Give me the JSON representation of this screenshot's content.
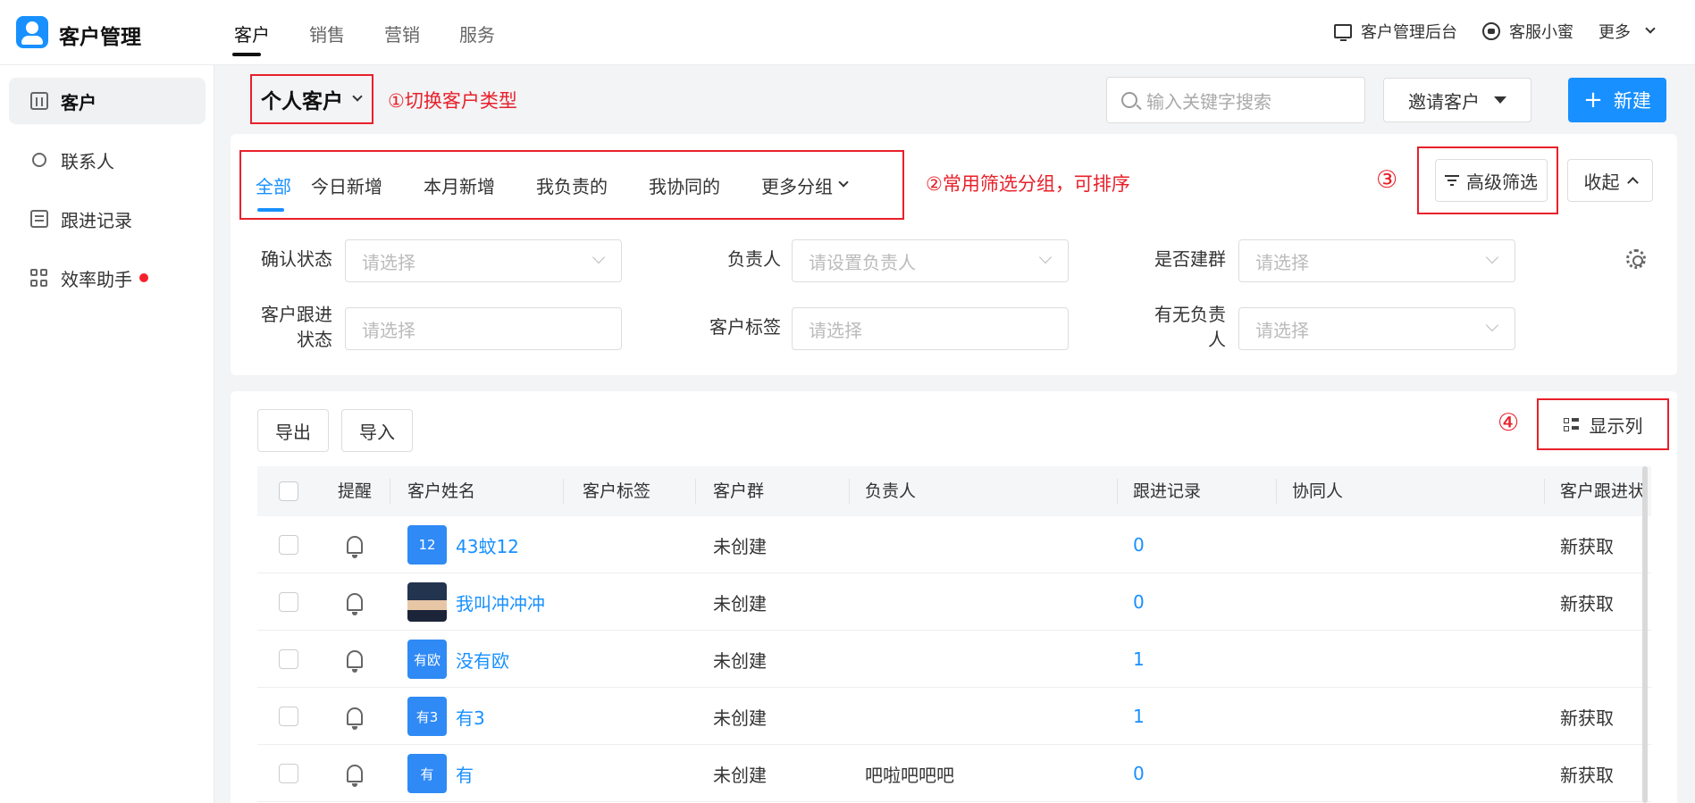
{
  "app": {
    "title": "客户管理"
  },
  "topnav": {
    "items": [
      "客户",
      "销售",
      "营销",
      "服务"
    ]
  },
  "topright": {
    "admin": "客户管理后台",
    "service": "客服小蜜",
    "more": "更多"
  },
  "sidebar": {
    "items": [
      {
        "label": "客户",
        "icon": "building-icon"
      },
      {
        "label": "联系人",
        "icon": "contact-icon"
      },
      {
        "label": "跟进记录",
        "icon": "record-icon"
      },
      {
        "label": "效率助手",
        "icon": "grid-icon",
        "badge": "red-dot"
      }
    ]
  },
  "header": {
    "customer_type": "个人客户",
    "anno1": "①切换客户类型",
    "search_placeholder": "输入关键字搜索",
    "invite": "邀请客户",
    "new": "新建"
  },
  "filters": {
    "tabs": [
      "全部",
      "今日新增",
      "本月新增",
      "我负责的",
      "我协同的"
    ],
    "more_tab": "更多分组",
    "anno2": "②常用筛选分组，可排序",
    "anno3": "③",
    "advanced": "高级筛选",
    "collapse": "收起",
    "fields": [
      {
        "label": "确认状态",
        "placeholder": "请选择"
      },
      {
        "label": "负责人",
        "placeholder": "请设置负责人"
      },
      {
        "label": "是否建群",
        "placeholder": "请选择"
      },
      {
        "label": "客户跟进\n状态",
        "placeholder": "请选择"
      },
      {
        "label": "客户标签",
        "placeholder": "请选择"
      },
      {
        "label": "有无负责\n人",
        "placeholder": "请选择"
      }
    ]
  },
  "table": {
    "export": "导出",
    "import": "导入",
    "anno4": "④",
    "show_columns": "显示列",
    "headers": [
      "提醒",
      "客户姓名",
      "客户标签",
      "客户群",
      "负责人",
      "跟进记录",
      "协同人",
      "客户跟进状"
    ],
    "rows": [
      {
        "avatar": "12",
        "name": "43蚊12",
        "group": "未创建",
        "owner": "",
        "records": "0",
        "status": "新获取"
      },
      {
        "avatar": "",
        "name": "我叫冲冲冲",
        "group": "未创建",
        "owner": "",
        "records": "0",
        "status": "新获取"
      },
      {
        "avatar": "有欧",
        "name": "没有欧",
        "group": "未创建",
        "owner": "",
        "records": "1",
        "status": ""
      },
      {
        "avatar": "有3",
        "name": "有3",
        "group": "未创建",
        "owner": "",
        "records": "1",
        "status": "新获取"
      },
      {
        "avatar": "有",
        "name": "有",
        "group": "未创建",
        "owner": "吧啦吧吧吧",
        "records": "0",
        "status": "新获取"
      }
    ]
  },
  "colors": {
    "accent": "#1890ff",
    "annotation": "#e8202a"
  }
}
